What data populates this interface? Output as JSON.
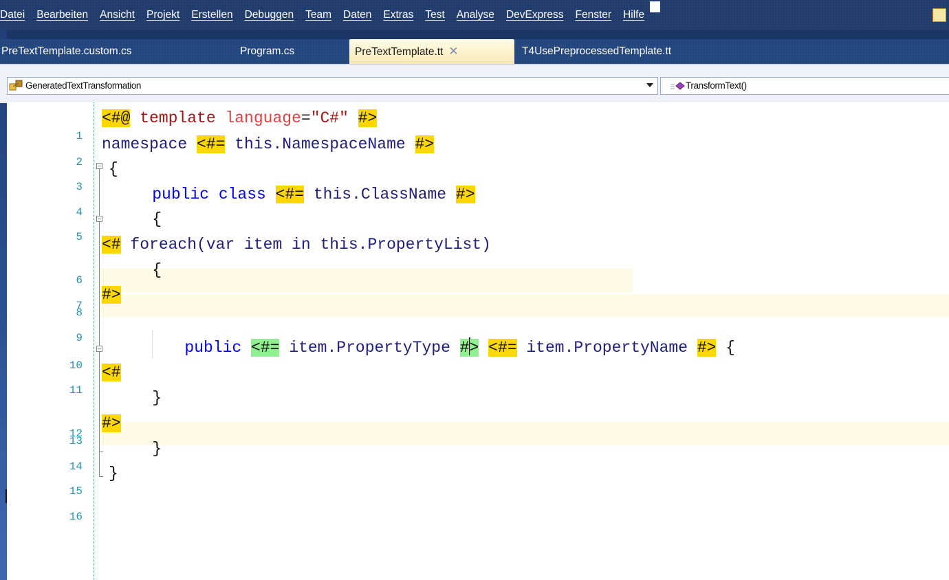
{
  "menu": {
    "items": [
      "Datei",
      "Bearbeiten",
      "Ansicht",
      "Projekt",
      "Erstellen",
      "Debuggen",
      "Team",
      "Daten",
      "Extras",
      "Test",
      "Analyse",
      "DevExpress",
      "Fenster",
      "Hilfe"
    ]
  },
  "tabs": [
    {
      "label": "PreTextTemplate.custom.cs",
      "active": false
    },
    {
      "label": "Program.cs",
      "active": false
    },
    {
      "label": "PreTextTemplate.tt",
      "active": true,
      "close": "✕"
    },
    {
      "label": "T4UsePreprocessedTemplate.tt",
      "active": false
    }
  ],
  "nav": {
    "class_dropdown": "GeneratedTextTransformation",
    "member_dropdown": "TransformText()"
  },
  "editor": {
    "line_numbers": [
      "1",
      "2",
      "3",
      "4",
      "5",
      "6",
      "7",
      "8",
      "9",
      "10",
      "11",
      "12",
      "13",
      "14",
      "15",
      "16"
    ],
    "l1": {
      "open": "<#@",
      "dir": " template ",
      "attr": "language",
      "eq": "=",
      "str": "\"C#\"",
      "sp": " ",
      "close": "#>"
    },
    "l2": {
      "a": "namespace ",
      "open": "<#=",
      "expr": " this.NamespaceName ",
      "close": "#>"
    },
    "l3": {
      "a": "{"
    },
    "l4": {
      "a": "    public class ",
      "open": "<#=",
      "expr": " this.ClassName ",
      "close": "#>"
    },
    "l5": {
      "a": "    {"
    },
    "l6": {
      "open": "<#",
      "expr": " foreach(var item in this.PropertyList)"
    },
    "l7": {
      "a": "    {"
    },
    "l8": {
      "close": "#>"
    },
    "l10": {
      "a": "        public ",
      "open1": "<#=",
      "expr1": " item.PropertyType ",
      "close1a": "#",
      "close1b": ">",
      "sp": " ",
      "open2": "<#=",
      "expr2": " item.PropertyName ",
      "close2": "#>",
      "tail": " {"
    },
    "l11": {
      "open": "<#"
    },
    "l12": {
      "a": "    }"
    },
    "l13": {
      "close": "#>"
    },
    "l14": {
      "a": "    }"
    },
    "l15": {
      "a": "}"
    }
  },
  "colors": {
    "control_block": "#ffd700",
    "active_block": "#8ef08e",
    "keyword": "#0000ff",
    "line_number": "#2b91af"
  }
}
